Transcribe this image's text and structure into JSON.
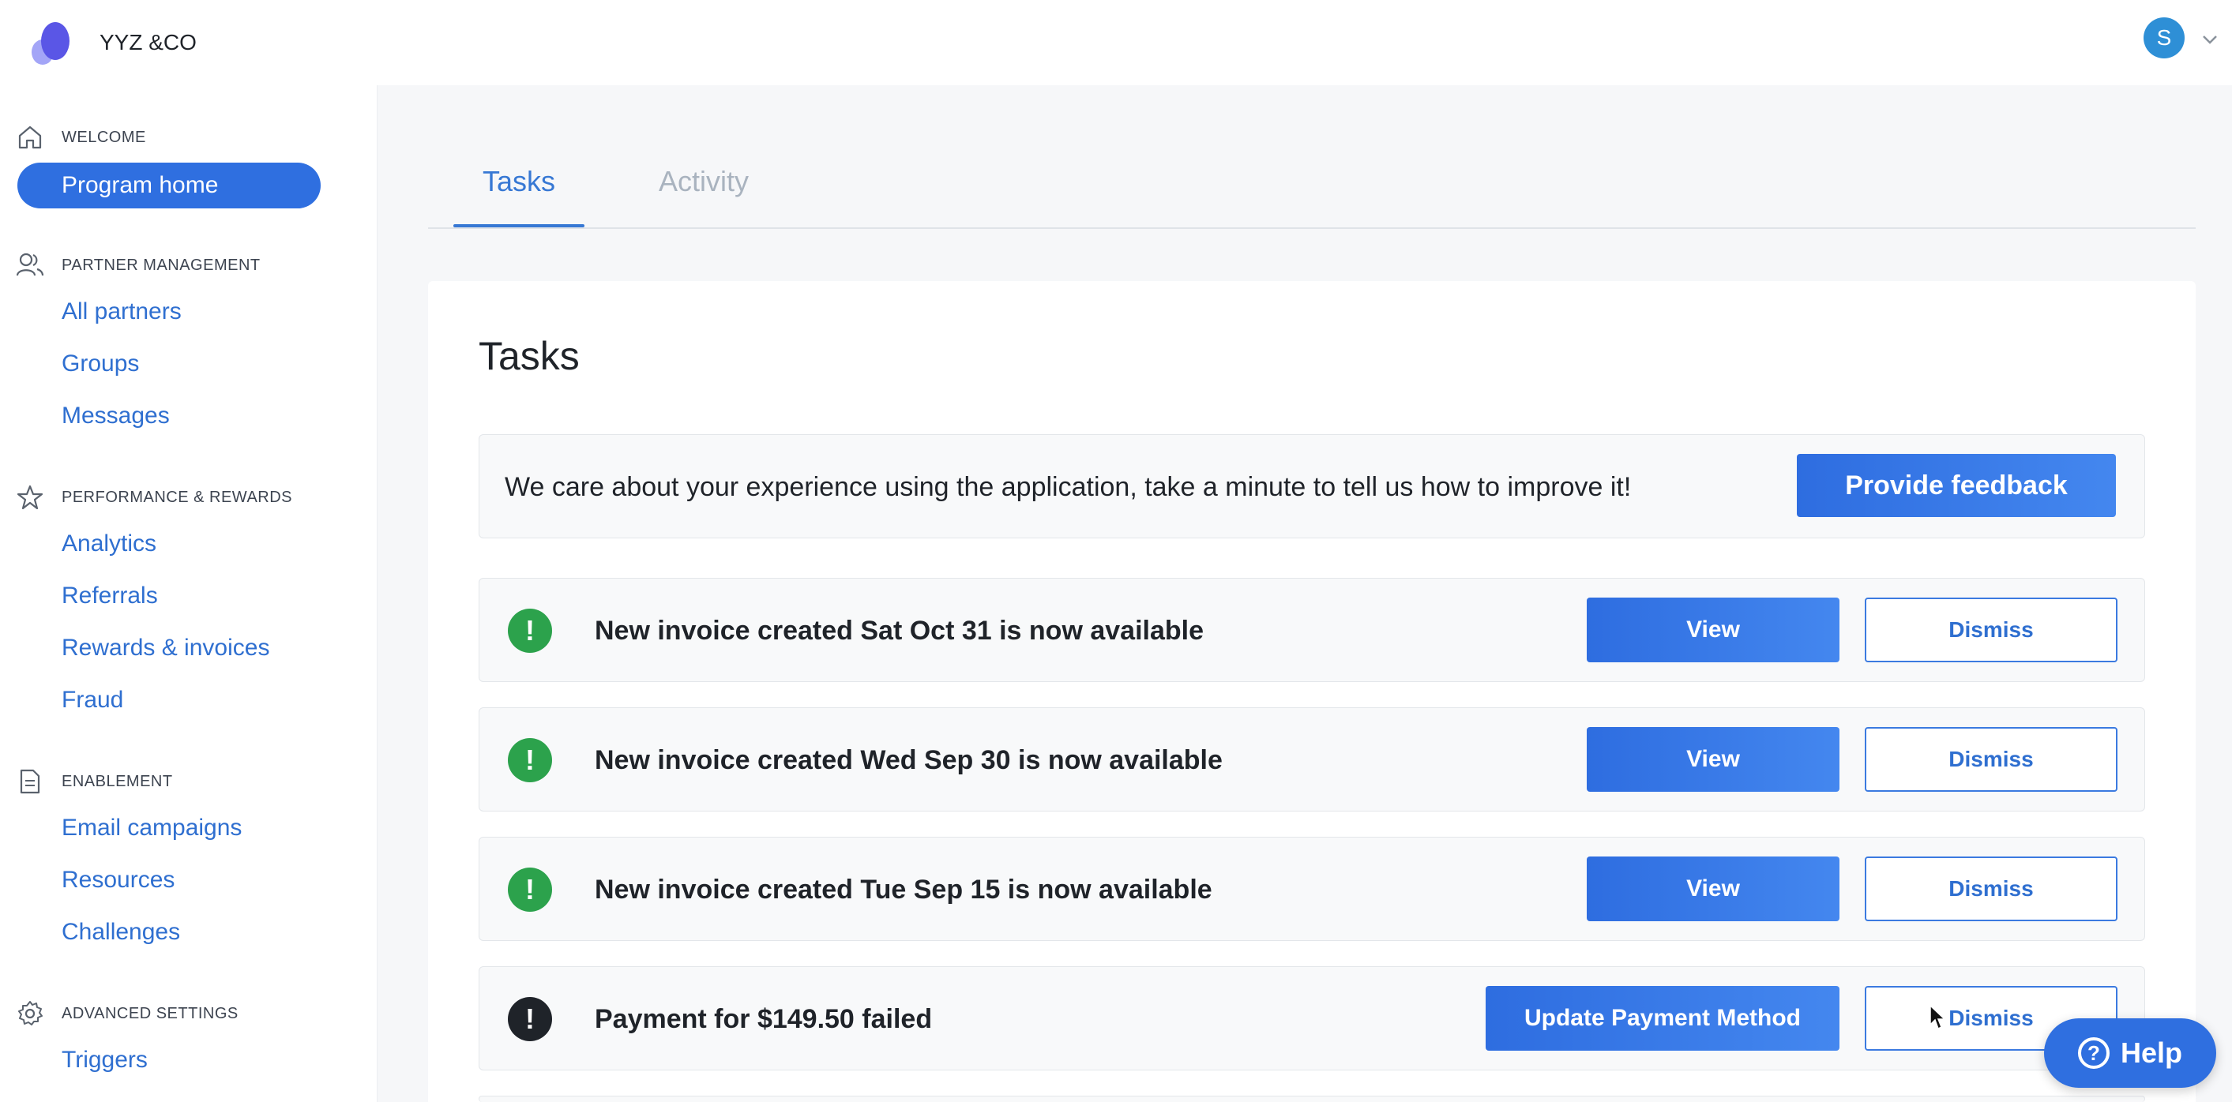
{
  "app": {
    "brand": "YYZ &CO",
    "avatar_initial": "S"
  },
  "sidebar": {
    "sections": [
      {
        "icon": "home-icon",
        "title": "WELCOME",
        "items": [
          "Program home"
        ]
      },
      {
        "icon": "users-icon",
        "title": "PARTNER MANAGEMENT",
        "items": [
          "All partners",
          "Groups",
          "Messages"
        ]
      },
      {
        "icon": "star-icon",
        "title": "PERFORMANCE & REWARDS",
        "items": [
          "Analytics",
          "Referrals",
          "Rewards & invoices",
          "Fraud"
        ]
      },
      {
        "icon": "document-icon",
        "title": "ENABLEMENT",
        "items": [
          "Email campaigns",
          "Resources",
          "Challenges"
        ]
      },
      {
        "icon": "gear-icon",
        "title": "ADVANCED SETTINGS",
        "items": [
          "Triggers"
        ]
      }
    ],
    "active_item": "Program home"
  },
  "tabs": [
    {
      "label": "Tasks",
      "active": true
    },
    {
      "label": "Activity",
      "active": false
    }
  ],
  "tasks": {
    "title": "Tasks",
    "feedback": {
      "text": "We care about your experience using the application, take a minute to tell us how to improve it!",
      "button": "Provide feedback"
    },
    "items": [
      {
        "status": "success",
        "text": "New invoice created Sat Oct 31 is now available",
        "primary": "View",
        "secondary": "Dismiss"
      },
      {
        "status": "success",
        "text": "New invoice created Wed Sep 30 is now available",
        "primary": "View",
        "secondary": "Dismiss"
      },
      {
        "status": "success",
        "text": "New invoice created Tue Sep 15 is now available",
        "primary": "View",
        "secondary": "Dismiss"
      },
      {
        "status": "error",
        "text": "Payment for $149.50 failed",
        "primary": "Update Payment Method",
        "secondary": "Dismiss"
      }
    ]
  },
  "help": {
    "label": "Help"
  },
  "colors": {
    "accent": "#2f6fe0",
    "success": "#2ca24c",
    "error": "#1f2329",
    "link": "#2f6fd0"
  }
}
